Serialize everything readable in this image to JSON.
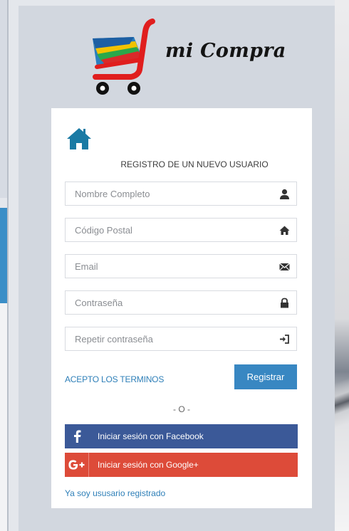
{
  "brand": {
    "name": "mi Compra"
  },
  "form": {
    "title": "REGISTRO DE UN NUEVO USUARIO",
    "fields": [
      {
        "placeholder": "Nombre Completo",
        "icon": "user-icon"
      },
      {
        "placeholder": "Código Postal",
        "icon": "home-icon"
      },
      {
        "placeholder": "Email",
        "icon": "envelope-icon"
      },
      {
        "placeholder": "Contraseña",
        "icon": "lock-icon"
      },
      {
        "placeholder": "Repetir contraseña",
        "icon": "login-icon"
      }
    ],
    "terms_label": "ACEPTO LOS TERMINOS",
    "register_label": "Registrar",
    "divider": "- O -",
    "facebook_label": "Iniciar sesión con Facebook",
    "google_label": "Iniciar sesión con Google+",
    "already_registered": "Ya soy ususario registrado"
  },
  "colors": {
    "panel": "#d2d7df",
    "accent": "#3887c2",
    "link": "#2e7fb8",
    "facebook": "#3b5998",
    "google": "#dd4b39",
    "home_icon": "#1a7aa4"
  }
}
